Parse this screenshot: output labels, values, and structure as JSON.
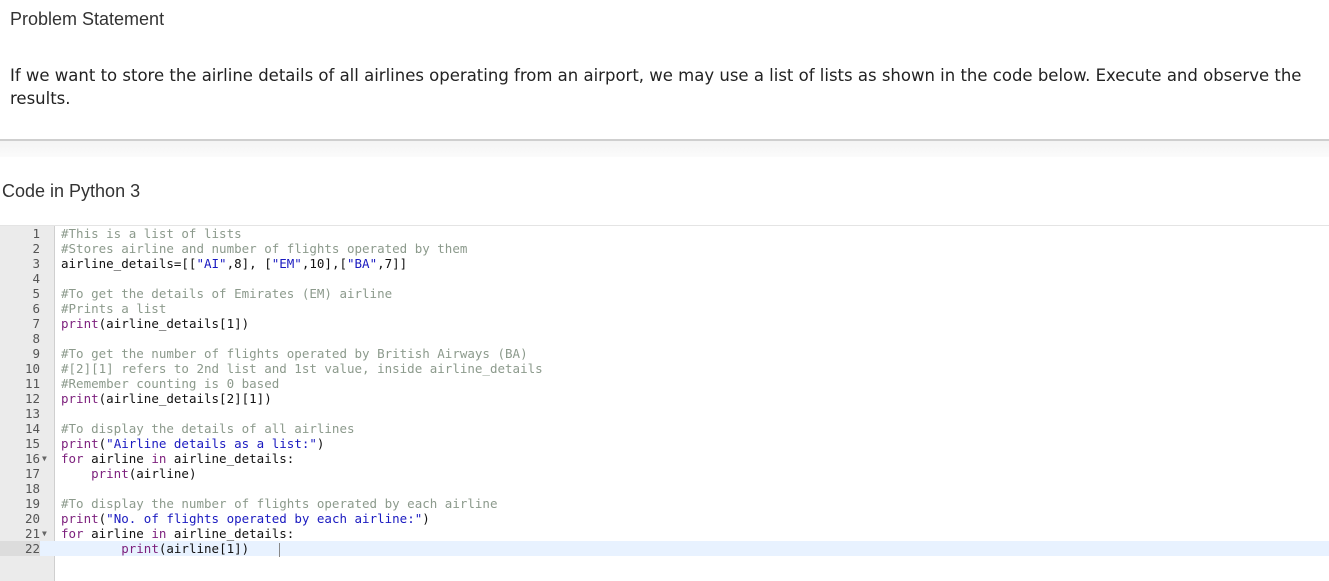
{
  "problem": {
    "title": "Problem Statement",
    "text": "If we want to store the airline details of all airlines operating from an airport, we may use a list of lists as shown in the code below. Execute and observe the results."
  },
  "code_section": {
    "title": "Code in Python 3",
    "active_line": 22,
    "lines": [
      {
        "n": "1",
        "tokens": [
          [
            "comment",
            "#This is a list of lists"
          ]
        ]
      },
      {
        "n": "2",
        "tokens": [
          [
            "comment",
            "#Stores airline and number of flights operated by them"
          ]
        ]
      },
      {
        "n": "3",
        "tokens": [
          [
            "plain",
            "airline_details=[["
          ],
          [
            "str",
            "\"AI\""
          ],
          [
            "plain",
            ",8], ["
          ],
          [
            "str",
            "\"EM\""
          ],
          [
            "plain",
            ",10],["
          ],
          [
            "str",
            "\"BA\""
          ],
          [
            "plain",
            ",7]]"
          ]
        ]
      },
      {
        "n": "4",
        "tokens": []
      },
      {
        "n": "5",
        "tokens": [
          [
            "comment",
            "#To get the details of Emirates (EM) airline"
          ]
        ]
      },
      {
        "n": "6",
        "tokens": [
          [
            "comment",
            "#Prints a list"
          ]
        ]
      },
      {
        "n": "7",
        "tokens": [
          [
            "kw",
            "print"
          ],
          [
            "plain",
            "(airline_details[1])"
          ]
        ]
      },
      {
        "n": "8",
        "tokens": []
      },
      {
        "n": "9",
        "tokens": [
          [
            "comment",
            "#To get the number of flights operated by British Airways (BA)"
          ]
        ]
      },
      {
        "n": "10",
        "tokens": [
          [
            "comment",
            "#[2][1] refers to 2nd list and 1st value, inside airline_details"
          ]
        ]
      },
      {
        "n": "11",
        "tokens": [
          [
            "comment",
            "#Remember counting is 0 based"
          ]
        ]
      },
      {
        "n": "12",
        "tokens": [
          [
            "kw",
            "print"
          ],
          [
            "plain",
            "(airline_details[2][1])"
          ]
        ]
      },
      {
        "n": "13",
        "tokens": []
      },
      {
        "n": "14",
        "tokens": [
          [
            "comment",
            "#To display the details of all airlines"
          ]
        ]
      },
      {
        "n": "15",
        "tokens": [
          [
            "kw",
            "print"
          ],
          [
            "plain",
            "("
          ],
          [
            "str",
            "\"Airline details as a list:\""
          ],
          [
            "plain",
            ")"
          ]
        ]
      },
      {
        "n": "16",
        "fold": true,
        "tokens": [
          [
            "kw",
            "for"
          ],
          [
            "plain",
            " airline "
          ],
          [
            "kw",
            "in"
          ],
          [
            "plain",
            " airline_details:"
          ]
        ]
      },
      {
        "n": "17",
        "tokens": [
          [
            "plain",
            "    "
          ],
          [
            "kw",
            "print"
          ],
          [
            "plain",
            "(airline)"
          ]
        ]
      },
      {
        "n": "18",
        "tokens": []
      },
      {
        "n": "19",
        "tokens": [
          [
            "comment",
            "#To display the number of flights operated by each airline"
          ]
        ]
      },
      {
        "n": "20",
        "tokens": [
          [
            "kw",
            "print"
          ],
          [
            "plain",
            "("
          ],
          [
            "str",
            "\"No. of flights operated by each airline:\""
          ],
          [
            "plain",
            ")"
          ]
        ]
      },
      {
        "n": "21",
        "fold": true,
        "tokens": [
          [
            "kw",
            "for"
          ],
          [
            "plain",
            " airline "
          ],
          [
            "kw",
            "in"
          ],
          [
            "plain",
            " airline_details:"
          ]
        ]
      },
      {
        "n": "22",
        "tokens": [
          [
            "plain",
            "        "
          ],
          [
            "kw",
            "print"
          ],
          [
            "plain",
            "(airline[1])"
          ]
        ]
      }
    ]
  }
}
